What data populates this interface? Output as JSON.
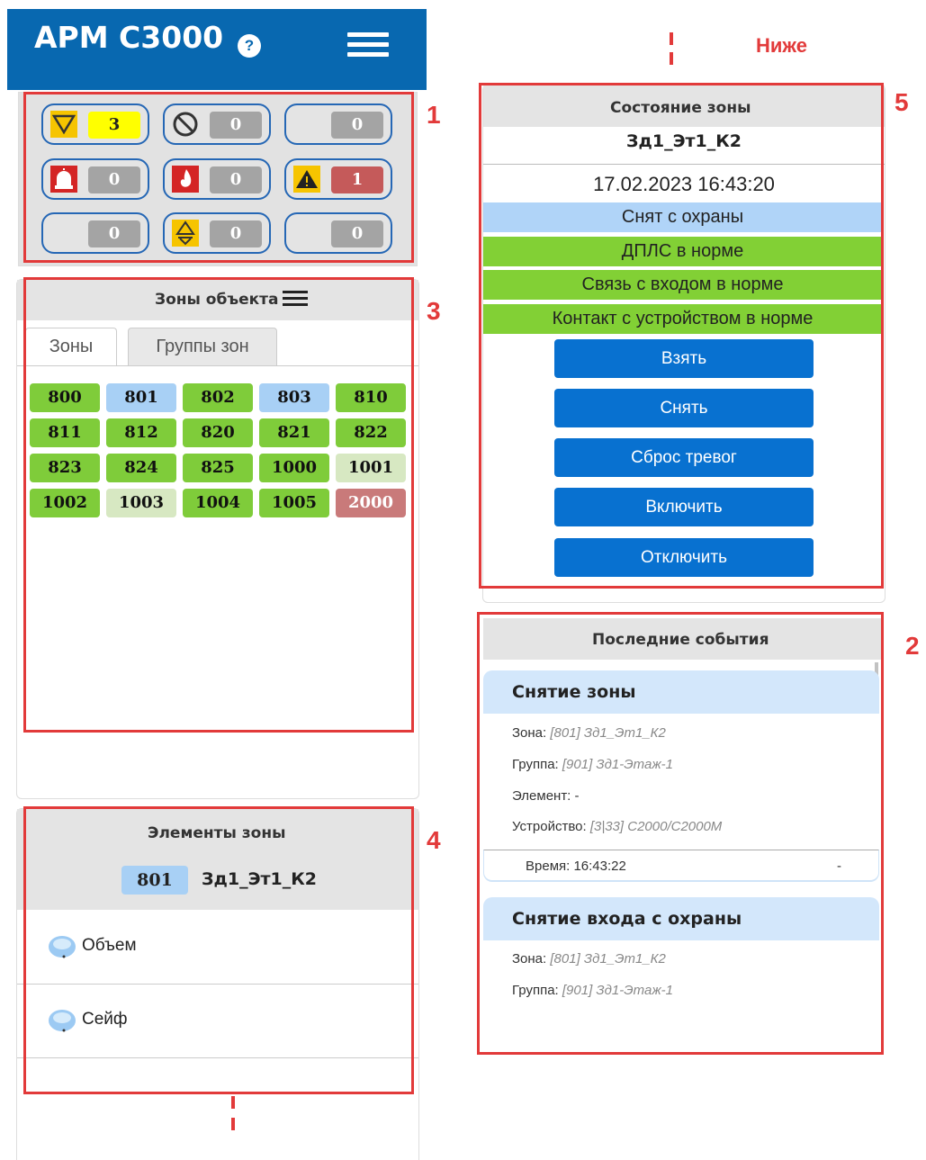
{
  "header": {
    "title": "АРМ С3000",
    "help_label": "?"
  },
  "counters": [
    {
      "icon": "fault-triangle-icon",
      "value": "3",
      "tone": "yellow"
    },
    {
      "icon": "disabled-circle-icon",
      "value": "0",
      "tone": "gray"
    },
    {
      "icon": "",
      "value": "0",
      "tone": "gray"
    },
    {
      "icon": "siren-alarm-icon",
      "value": "0",
      "tone": "gray"
    },
    {
      "icon": "fire-icon",
      "value": "0",
      "tone": "gray"
    },
    {
      "icon": "warning-icon",
      "value": "1",
      "tone": "red"
    },
    {
      "icon": "",
      "value": "0",
      "tone": "gray"
    },
    {
      "icon": "attention-arrow-icon",
      "value": "0",
      "tone": "gray"
    },
    {
      "icon": "",
      "value": "0",
      "tone": "gray"
    }
  ],
  "zones_panel": {
    "title": "Зоны объекта",
    "tabs": [
      "Зоны",
      "Группы зон"
    ],
    "zones": [
      {
        "num": "800",
        "state": "g"
      },
      {
        "num": "801",
        "state": "b"
      },
      {
        "num": "802",
        "state": "g"
      },
      {
        "num": "803",
        "state": "b"
      },
      {
        "num": "810",
        "state": "g"
      },
      {
        "num": "811",
        "state": "g"
      },
      {
        "num": "812",
        "state": "g"
      },
      {
        "num": "820",
        "state": "g"
      },
      {
        "num": "821",
        "state": "g"
      },
      {
        "num": "822",
        "state": "g"
      },
      {
        "num": "823",
        "state": "g"
      },
      {
        "num": "824",
        "state": "g"
      },
      {
        "num": "825",
        "state": "g"
      },
      {
        "num": "1000",
        "state": "g"
      },
      {
        "num": "1001",
        "state": "lg"
      },
      {
        "num": "1002",
        "state": "g"
      },
      {
        "num": "1003",
        "state": "lg"
      },
      {
        "num": "1004",
        "state": "g"
      },
      {
        "num": "1005",
        "state": "g"
      },
      {
        "num": "2000",
        "state": "r"
      }
    ]
  },
  "elements_panel": {
    "title": "Элементы зоны",
    "zone_num": "801",
    "zone_name": "Зд1_Эт1_К2",
    "items": [
      {
        "label": "Объем",
        "icon": "smoke-detector-icon"
      },
      {
        "label": "Сейф",
        "icon": "smoke-detector-icon"
      }
    ]
  },
  "state_panel": {
    "title": "Состояние зоны",
    "zone_name": "Зд1_Эт1_К2",
    "datetime": "17.02.2023 16:43:20",
    "statuses": [
      {
        "text": "Снят с охраны",
        "color": "#b0d4f8"
      },
      {
        "text": "ДПЛС в норме",
        "color": "#82d035"
      },
      {
        "text": "Связь с входом в норме",
        "color": "#82d035"
      },
      {
        "text": "Контакт с устройством в норме",
        "color": "#82d035"
      }
    ],
    "buttons": [
      "Взять",
      "Снять",
      "Сброс тревог",
      "Включить",
      "Отключить"
    ]
  },
  "events_panel": {
    "title": "Последние события",
    "events": [
      {
        "title": "Снятие зоны",
        "zone_label": "Зона:",
        "zone_value": "[801] Зд1_Эт1_К2",
        "group_label": "Группа:",
        "group_value": "[901] Зд1-Этаж-1",
        "element_label": "Элемент:",
        "element_value": "-",
        "device_label": "Устройство:",
        "device_value": "[3|33] С2000/С2000М",
        "time": "Время: 16:43:22",
        "extra": "-"
      },
      {
        "title": "Снятие входа с охраны",
        "zone_label": "Зона:",
        "zone_value": "[801] Зд1_Эт1_К2",
        "group_label": "Группа:",
        "group_value": "[901] Зд1-Этаж-1"
      }
    ]
  },
  "annotations": {
    "below_label": "Ниже",
    "box_1": "1",
    "box_2": "2",
    "box_3": "3",
    "box_4": "4",
    "box_5": "5",
    "color": "#e23a3a"
  }
}
